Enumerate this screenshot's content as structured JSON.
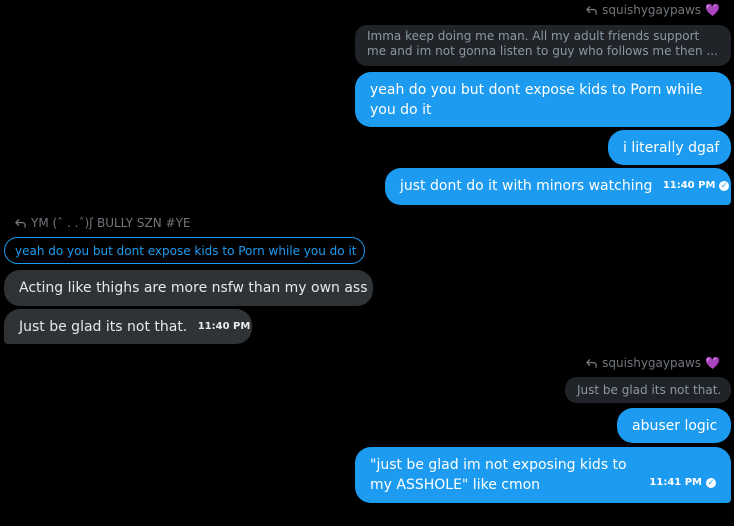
{
  "colors": {
    "background": "#000000",
    "sent_bubble": "#1d9bf0",
    "received_bubble": "#2f3336",
    "quote_bubble": "#202327",
    "muted_text": "#71767b",
    "heart": "#a855f7"
  },
  "icons": {
    "reply": "reply-arrow-icon",
    "heart": "purple-heart-icon",
    "read": "read-check-icon"
  },
  "thread": {
    "reply_1": {
      "to_user": "squishygaypaws",
      "heart": "💜",
      "quoted_text": "Imma keep doing me man. All my adult friends support me and im not gonna listen to guy who follows me then ..."
    },
    "msg_1": "yeah do you but dont expose kids to Porn while you do it",
    "msg_2": "i literally dgaf",
    "msg_3": {
      "text": "just dont do it with minors watching",
      "time": "11:40 PM"
    },
    "reply_2": {
      "to_user": "YM (ˆ . .ˆ)ʃ BULLY SZN #YE",
      "quoted_text": "yeah do you but dont expose kids to Porn while you do it"
    },
    "msg_4": "Acting like thighs are more nsfw than my own ass",
    "msg_5": {
      "text": "Just be glad its not that.",
      "time": "11:40 PM"
    },
    "reply_3": {
      "to_user": "squishygaypaws",
      "heart": "💜",
      "quoted_text": "Just be glad its not that."
    },
    "msg_6": "abuser logic",
    "msg_7": {
      "text": "\"just be glad im not exposing kids to my ASSHOLE\" like cmon",
      "time": "11:41 PM"
    }
  }
}
